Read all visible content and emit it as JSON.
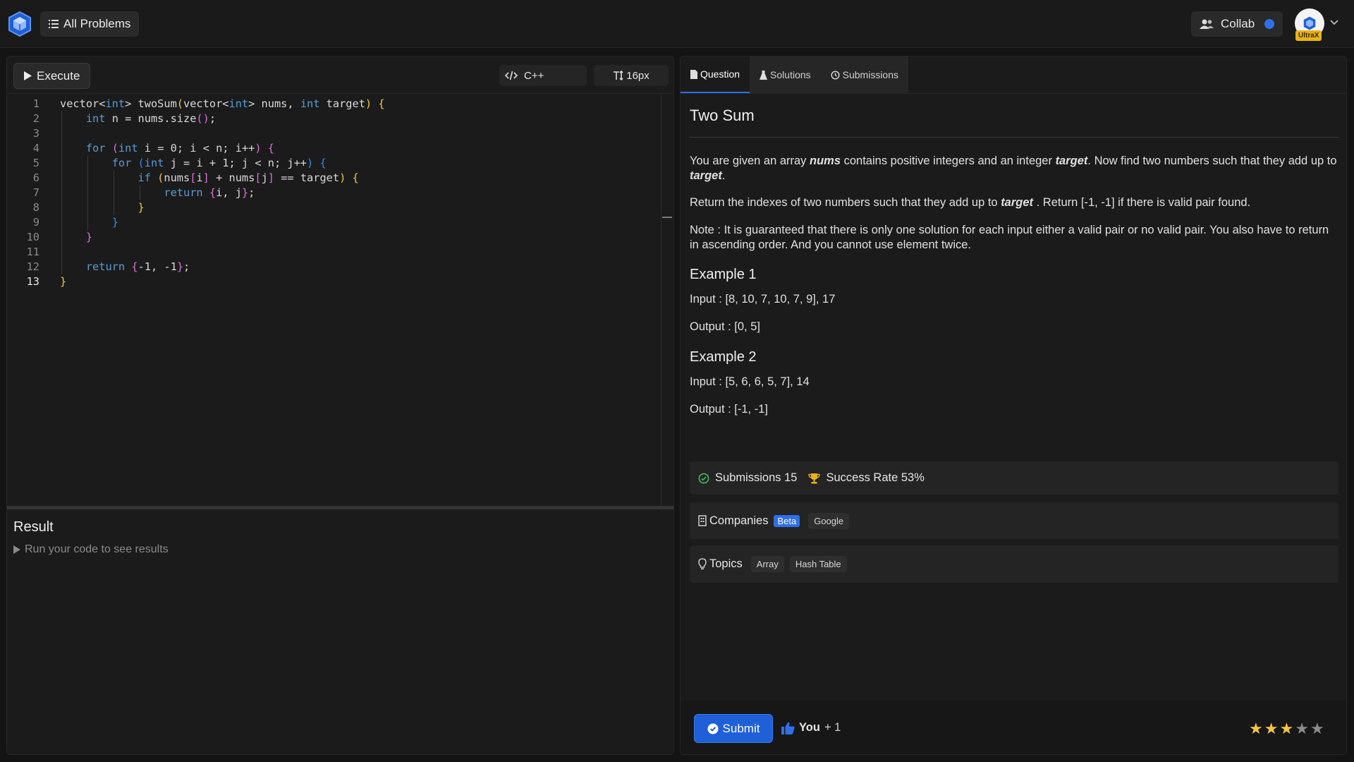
{
  "header": {
    "all_problems": "All Problems",
    "collab": "Collab",
    "avatar_badge": "UltraX"
  },
  "editor": {
    "execute_label": "Execute",
    "language": "C++",
    "font_size": "16px",
    "lines": [
      "vector<int> twoSum(vector<int> nums, int target) {",
      "    int n = nums.size();",
      "",
      "    for (int i = 0; i < n; i++) {",
      "        for (int j = i + 1; j < n; j++) {",
      "            if (nums[i] + nums[j] == target) {",
      "                return {i, j};",
      "            }",
      "        }",
      "    }",
      "",
      "    return {-1, -1};",
      "}"
    ],
    "line_numbers": [
      "1",
      "2",
      "3",
      "4",
      "5",
      "6",
      "7",
      "8",
      "9",
      "10",
      "11",
      "12",
      "13"
    ]
  },
  "result": {
    "title": "Result",
    "hint": "Run your code to see results"
  },
  "tabs": [
    "Question",
    "Solutions",
    "Submissions"
  ],
  "question": {
    "title": "Two Sum",
    "p1_a": "You are given an array ",
    "p1_nums": "nums",
    "p1_b": " contains positive integers and an integer ",
    "p1_target": "target",
    "p1_c": ". Now find two numbers such that they add up to ",
    "p1_target2": "target",
    "p1_d": ".",
    "p2_a": "Return the indexes of two numbers such that they add up to ",
    "p2_target": "target",
    "p2_b": " . Return [-1, -1] if there is valid pair found.",
    "note": "Note : It is guaranteed that there is only one solution for each input either a valid pair or no valid pair. You also have to return in ascending order. And you cannot use element twice.",
    "example1_title": "Example 1",
    "example1_input": "Input : [8, 10, 7, 10, 7, 9], 17",
    "example1_output": "Output : [0, 5]",
    "example2_title": "Example 2",
    "example2_input": "Input : [5, 6, 6, 5, 7], 14",
    "example2_output": "Output : [-1, -1]"
  },
  "stats": {
    "submissions": "Submissions 15",
    "success_rate": "Success Rate 53%",
    "companies_label": "Companies",
    "beta": "Beta",
    "companies": [
      "Google"
    ],
    "topics_label": "Topics",
    "topics": [
      "Array",
      "Hash Table"
    ]
  },
  "footer": {
    "submit": "Submit",
    "likes_you": "You",
    "likes_plus": "+ 1",
    "rating": 3,
    "rating_max": 5
  },
  "colors": {
    "accent": "#2f6fe8",
    "star_on": "#f5c542",
    "star_off": "#8a8a8a",
    "success": "#3fbf5f",
    "trophy": "#e8b317"
  }
}
